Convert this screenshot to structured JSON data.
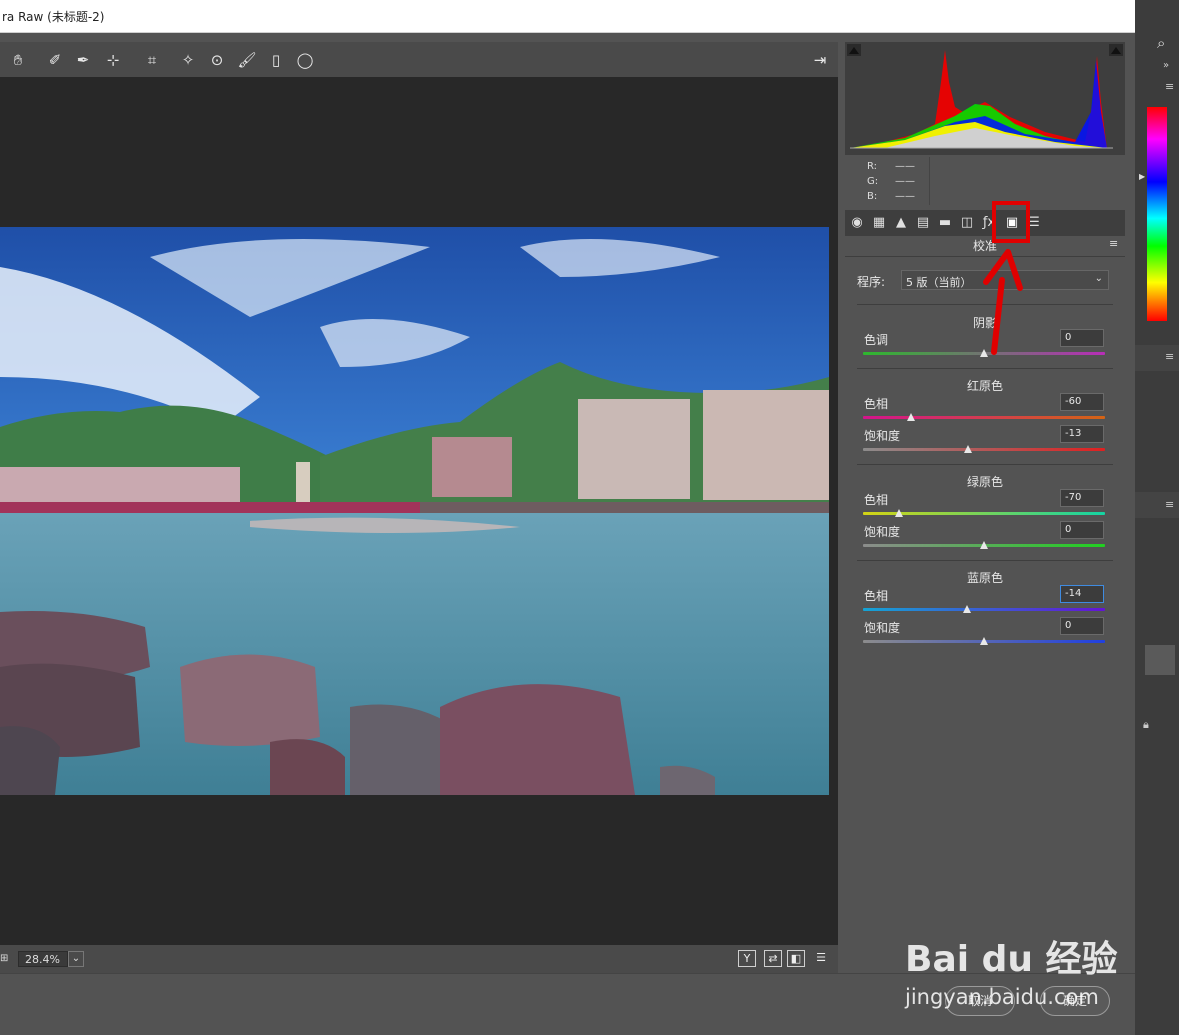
{
  "window": {
    "title": "ra Raw (未标题-2)"
  },
  "toolbar": {
    "tools": [
      "hand-tool",
      "white-balance-tool",
      "color-sampler-tool",
      "targeted-adjustment-tool",
      "crop-tool",
      "spot-removal-tool",
      "red-eye-tool",
      "adjustment-brush-tool",
      "graduated-filter-tool",
      "radial-filter-tool"
    ]
  },
  "status": {
    "zoom": "28.4%",
    "view_buttons": [
      "Y",
      "⇄",
      "◧",
      "☰"
    ]
  },
  "histogram": {
    "r_label": "R:",
    "g_label": "G:",
    "b_label": "B:",
    "r_value": "——",
    "g_value": "——",
    "b_value": "——"
  },
  "panel": {
    "title": "校准",
    "process_label": "程序:",
    "process_value": "5 版（当前）",
    "shadows": {
      "title": "阴影",
      "tint_label": "色调",
      "tint_value": "0",
      "tint_pos": 0.5
    },
    "red": {
      "title": "红原色",
      "hue_label": "色相",
      "hue_value": "-60",
      "hue_pos": 0.2,
      "sat_label": "饱和度",
      "sat_value": "-13",
      "sat_pos": 0.435
    },
    "green": {
      "title": "绿原色",
      "hue_label": "色相",
      "hue_value": "-70",
      "hue_pos": 0.15,
      "sat_label": "饱和度",
      "sat_value": "0",
      "sat_pos": 0.5
    },
    "blue": {
      "title": "蓝原色",
      "hue_label": "色相",
      "hue_value": "-14",
      "hue_pos": 0.43,
      "sat_label": "饱和度",
      "sat_value": "0",
      "sat_pos": 0.5
    }
  },
  "buttons": {
    "cancel": "取消",
    "ok": "确定"
  },
  "watermark": {
    "brand": "Bai du 经验",
    "url": "jingyan.baidu.com"
  },
  "colors": {
    "accent_red": "#e00000"
  }
}
